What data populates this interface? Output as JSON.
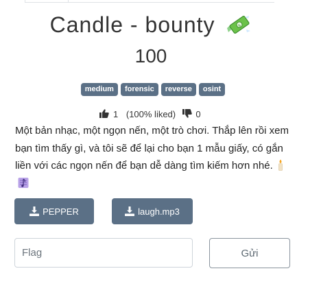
{
  "challenge": {
    "title": "Candle - bounty",
    "title_icon": "money-with-wings-icon",
    "points": "100",
    "tags": [
      "medium",
      "forensic",
      "reverse",
      "osint"
    ],
    "votes": {
      "likes": "1",
      "liked_text": "(100% liked)",
      "dislikes": "0"
    },
    "description": "Một bản nhạc, một ngọn nến, một trò chơi. Thắp lên rồi xem bạn tìm thấy gì, và tôi sẽ để lại cho bạn 1 mẫu giấy, có gắn liền với các ngọn nến để bạn dễ dàng tìm kiếm hơn nhé.",
    "description_icons": [
      "candle-icon",
      "music-score-icon"
    ],
    "files": [
      {
        "label": "PEPPER",
        "icon": "download-icon"
      },
      {
        "label": "laugh.mp3",
        "icon": "download-icon"
      }
    ],
    "flag_placeholder": "Flag",
    "submit_label": "Gửi"
  },
  "colors": {
    "tag_bg": "#5b7086",
    "button_bg": "#5b7086",
    "text": "#333333"
  }
}
